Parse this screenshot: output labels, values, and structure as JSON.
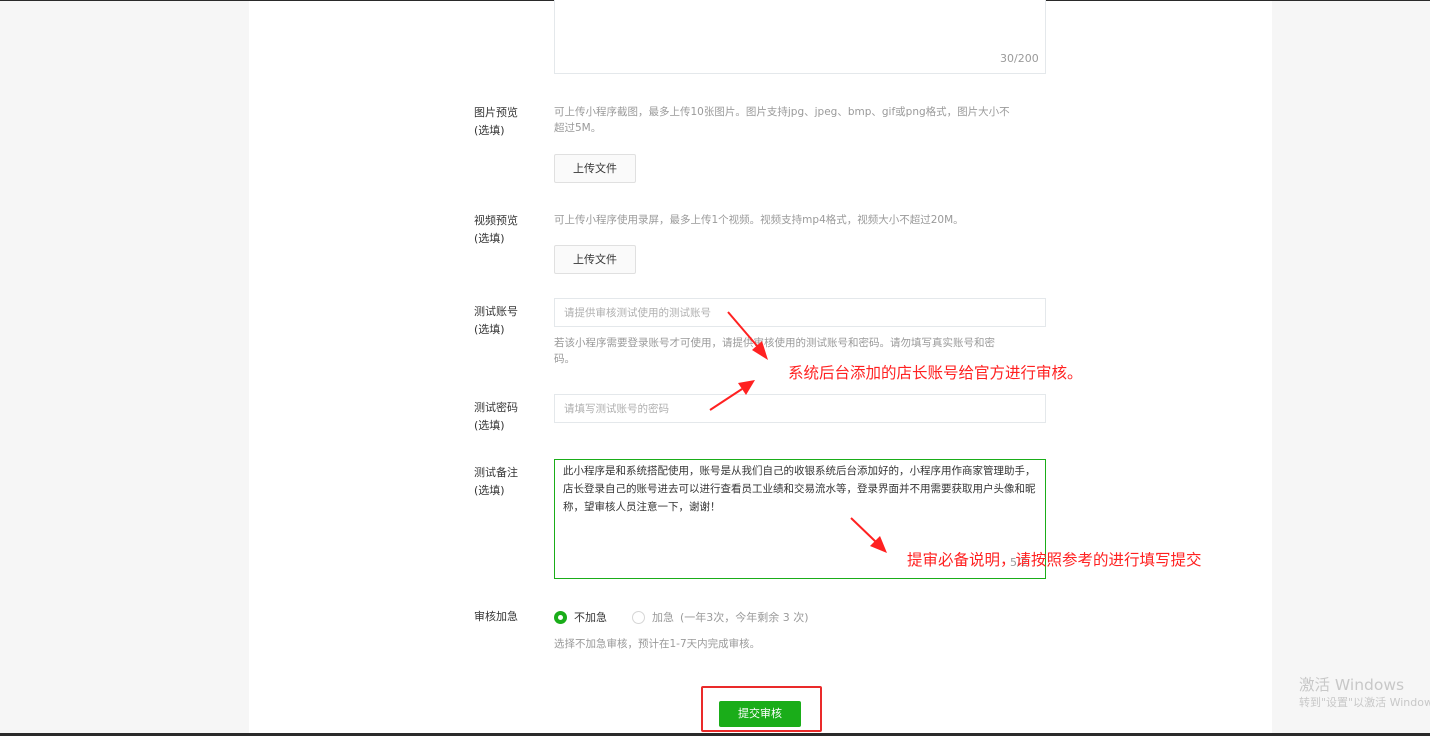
{
  "description_field": {
    "counter": "30/200"
  },
  "image_preview": {
    "label_line1": "图片预览",
    "label_line2": "(选填)",
    "hint_line1": "可上传小程序截图，最多上传10张图片。图片支持jpg、jpeg、bmp、gif或png格式，图片大小不",
    "hint_line2": "超过5M。",
    "upload_label": "上传文件"
  },
  "video_preview": {
    "label_line1": "视频预览",
    "label_line2": "(选填)",
    "hint": "可上传小程序使用录屏，最多上传1个视频。视频支持mp4格式，视频大小不超过20M。",
    "upload_label": "上传文件"
  },
  "test_account": {
    "label_line1": "测试账号",
    "label_line2": "(选填)",
    "placeholder": "请提供审核测试使用的测试账号",
    "hint_line1": "若该小程序需要登录账号才可使用，请提供审核使用的测试账号和密码。请勿填写真实账号和密",
    "hint_line2": "码。"
  },
  "test_password": {
    "label_line1": "测试密码",
    "label_line2": "(选填)",
    "placeholder": "请填写测试账号的密码"
  },
  "test_notes": {
    "label_line1": "测试备注",
    "label_line2": "(选填)",
    "value": "此小程序是和系统搭配使用，账号是从我们自己的收银系统后台添加好的，小程序用作商家管理助手，店长登录自己的账号进去可以进行查看员工业绩和交易流水等，登录界面并不用需要获取用户头像和昵称，望审核人员注意一下，谢谢！",
    "counter_partial": "5/2"
  },
  "review_priority": {
    "label": "审核加急",
    "option_normal": "不加急",
    "option_urgent": "加急",
    "urgent_note": "(一年3次，今年剩余 3 次)",
    "hint": "选择不加急审核，预计在1-7天内完成审核。",
    "selected": "不加急"
  },
  "submit_label": "提交审核",
  "annotations": {
    "account_note": "系统后台添加的店长账号给官方进行审核。",
    "notes_note": "提审必备说明，请按照参考的进行填写提交"
  },
  "watermark": {
    "line1": "激活 Windows",
    "line2": "转到\"设置\"以激活 Windows。"
  },
  "colors": {
    "accent": "#1aad19",
    "annotation": "#ff2121",
    "hint_text": "#9a9a9a"
  }
}
